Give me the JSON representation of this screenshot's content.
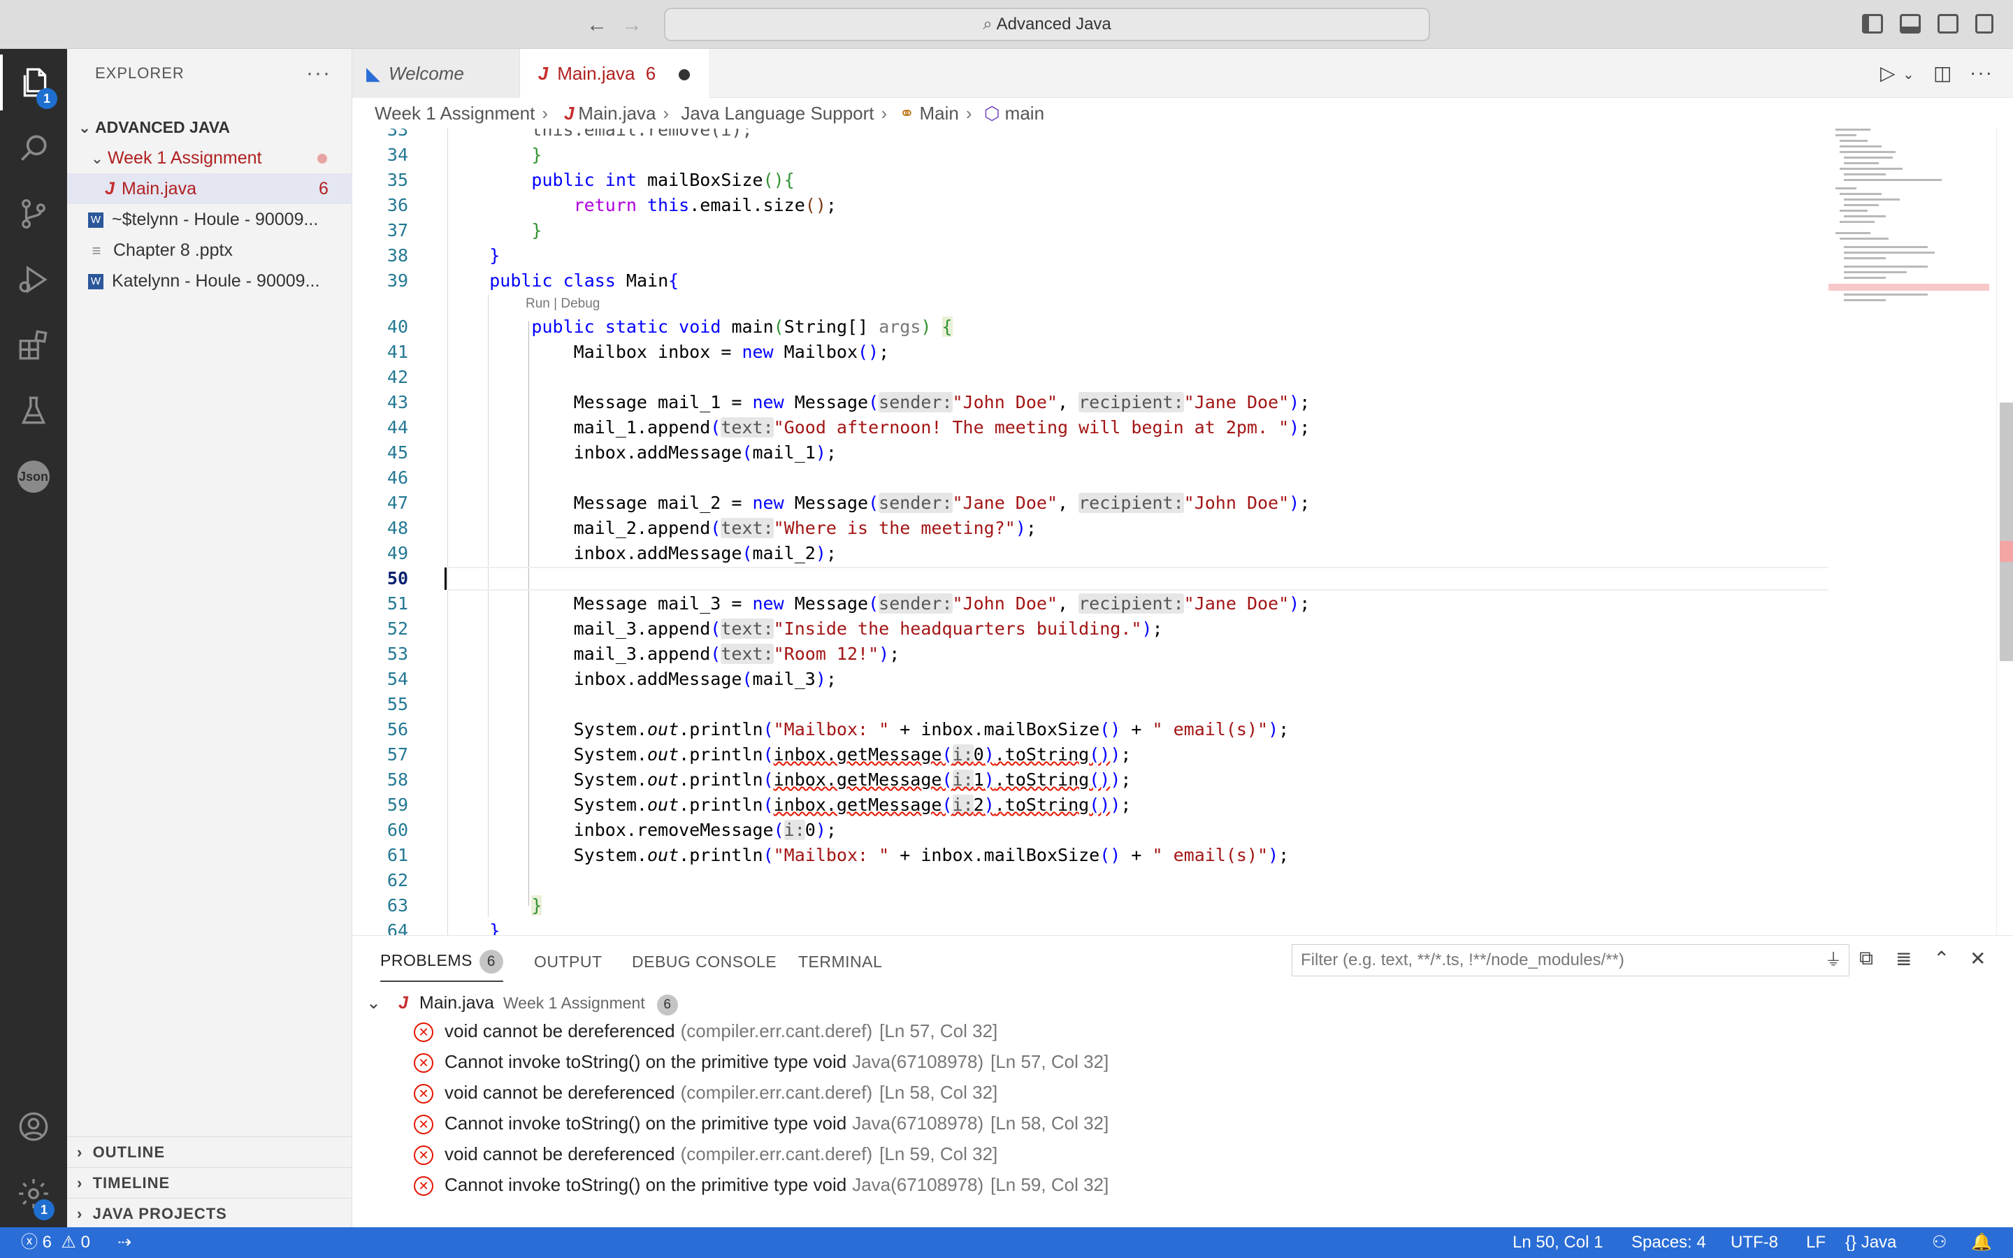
{
  "window": {
    "title": "Advanced Java",
    "back_glyph": "←",
    "forward_glyph": "→"
  },
  "activity_bar": {
    "items": [
      {
        "icon": "files-icon",
        "badge": "1"
      },
      {
        "icon": "search-icon"
      },
      {
        "icon": "source-control-icon"
      },
      {
        "icon": "run-debug-icon"
      },
      {
        "icon": "extensions-icon"
      },
      {
        "icon": "testing-icon"
      },
      {
        "icon": "json-icon",
        "label": "Json"
      }
    ],
    "bottom": [
      {
        "icon": "account-icon"
      },
      {
        "icon": "settings-gear-icon",
        "badge": "1"
      }
    ]
  },
  "explorer": {
    "title": "EXPLORER",
    "more": "···",
    "root": "ADVANCED JAVA",
    "folder": "Week 1 Assignment",
    "files": [
      {
        "name": "Main.java",
        "badge": "6",
        "icon": "java-file-icon"
      },
      {
        "name": "~$telynn - Houle - 90009...",
        "icon": "word-file-icon"
      },
      {
        "name": "Chapter 8 .pptx",
        "icon": "text-file-icon"
      },
      {
        "name": "Katelynn - Houle - 90009...",
        "icon": "word-file-icon"
      }
    ],
    "sections": [
      "OUTLINE",
      "TIMELINE",
      "JAVA PROJECTS"
    ]
  },
  "tabs": [
    {
      "label": "Welcome",
      "active": false
    },
    {
      "label": "Main.java",
      "count": "6",
      "active": true,
      "dirty": true
    }
  ],
  "breadcrumb": [
    "Week 1 Assignment",
    "Main.java",
    "Java Language Support",
    "Main",
    "main"
  ],
  "editor": {
    "codelens": "Run | Debug",
    "current_line": 50
  },
  "panel": {
    "tabs": [
      {
        "label": "PROBLEMS",
        "badge": "6",
        "active": true
      },
      {
        "label": "OUTPUT"
      },
      {
        "label": "DEBUG CONSOLE"
      },
      {
        "label": "TERMINAL"
      }
    ],
    "filter_placeholder": "Filter (e.g. text, **/*.ts, !**/node_modules/**)",
    "group": {
      "file": "Main.java",
      "folder": "Week 1 Assignment",
      "count": "6"
    },
    "problems": [
      {
        "message": "void cannot be dereferenced",
        "source": "(compiler.err.cant.deref)",
        "location": "[Ln 57, Col 32]"
      },
      {
        "message": "Cannot invoke toString() on the primitive type void",
        "source": "Java(67108978)",
        "location": "[Ln 57, Col 32]"
      },
      {
        "message": "void cannot be dereferenced",
        "source": "(compiler.err.cant.deref)",
        "location": "[Ln 58, Col 32]"
      },
      {
        "message": "Cannot invoke toString() on the primitive type void",
        "source": "Java(67108978)",
        "location": "[Ln 58, Col 32]"
      },
      {
        "message": "void cannot be dereferenced",
        "source": "(compiler.err.cant.deref)",
        "location": "[Ln 59, Col 32]"
      },
      {
        "message": "Cannot invoke toString() on the primitive type void",
        "source": "Java(67108978)",
        "location": "[Ln 59, Col 32]"
      }
    ]
  },
  "status_bar": {
    "errors": "6",
    "warnings": "0",
    "cursor": "Ln 50, Col 1",
    "spaces": "Spaces: 4",
    "encoding": "UTF-8",
    "eol": "LF",
    "language": "Java"
  },
  "colors": {
    "status_bar": "#2a6dd6",
    "activity_bar": "#2c2c2c",
    "error": "#e51400",
    "keyword": "#0000ff",
    "string": "#a31515"
  }
}
